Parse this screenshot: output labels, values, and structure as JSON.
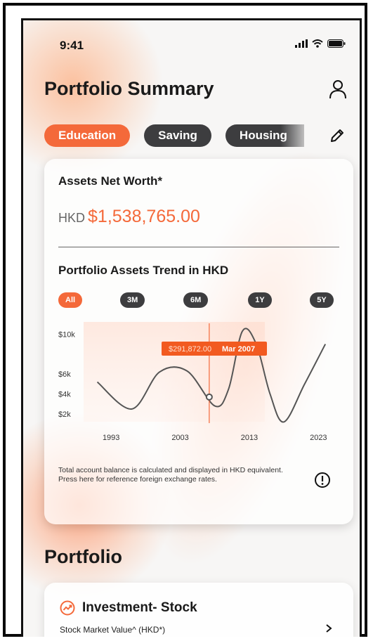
{
  "status": {
    "time": "9:41"
  },
  "header": {
    "title": "Portfolio Summary"
  },
  "chips": [
    {
      "label": "Education",
      "active": true
    },
    {
      "label": "Saving",
      "active": false
    },
    {
      "label": "Housing",
      "active": false
    }
  ],
  "networth": {
    "label": "Assets Net Worth*",
    "currency": "HKD",
    "amount": "$1,538,765.00"
  },
  "trend": {
    "title": "Portfolio Assets Trend in HKD",
    "ranges": [
      "All",
      "3M",
      "6M",
      "1Y",
      "5Y"
    ],
    "active_range": "All"
  },
  "chart_data": {
    "type": "line",
    "x_ticks": [
      "1993",
      "2003",
      "2013",
      "2023"
    ],
    "y_ticks": [
      "$10k",
      "$6k",
      "$4k",
      "$2k"
    ],
    "x": [
      1991,
      1996,
      2000,
      2004,
      2008,
      2010,
      2012,
      2014,
      2016,
      2018,
      2021,
      2024
    ],
    "y": [
      5.2,
      2.5,
      6.2,
      6.3,
      2.8,
      4.5,
      10.3,
      9.0,
      4.0,
      1.2,
      5.0,
      9.0
    ],
    "tooltip": {
      "value": "$291,872.00",
      "date": "Mar 2007"
    },
    "colors": {
      "line": "#555555",
      "accent": "#f4693a"
    }
  },
  "note": {
    "line1": "Total account balance is calculated and displayed in HKD equivalent.",
    "line2": "Press here for reference foreign exchange rates."
  },
  "portfolio": {
    "title": "Portfolio",
    "card_title": "Investment- Stock",
    "card_sub": "Stock Market Value^ (HKD*)"
  }
}
